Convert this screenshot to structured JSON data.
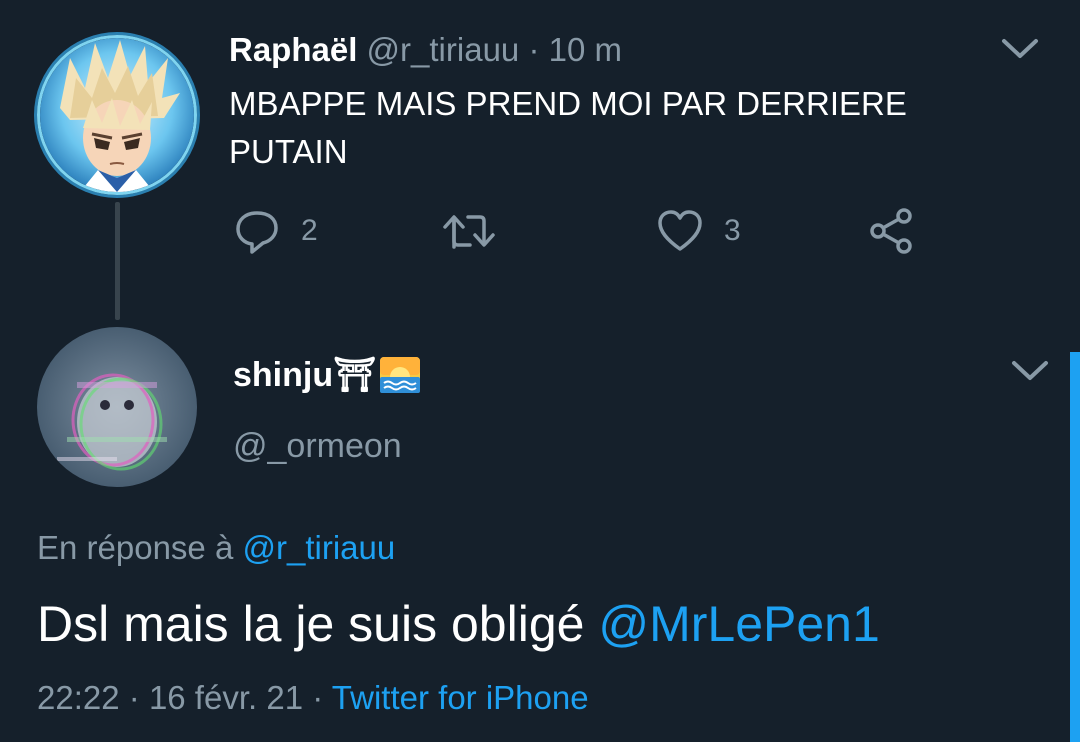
{
  "parent_tweet": {
    "display_name": "Raphaël",
    "handle": "@r_tiriauu",
    "separator": "·",
    "time": "10 m",
    "text": "MBAPPE MAIS PREND MOI PAR DERRIERE\nPUTAIN",
    "reply_count": "2",
    "like_count": "3",
    "avatar_icon": "anime-character-avatar",
    "menu_icon": "chevron-down-icon"
  },
  "reply_tweet": {
    "display_name": "shinju⛩",
    "handle": "@_ormeon",
    "avatar_icon": "glitch-art-avatar",
    "in_reply_label": "En réponse à",
    "in_reply_handle": "@r_tiriauu",
    "text_prefix": "Dsl mais la je suis obligé ",
    "text_mention": "@MrLePen1",
    "time": "22:22",
    "separator": "·",
    "date": "16 févr. 21",
    "source": "Twitter for iPhone",
    "menu_icon": "chevron-down-icon"
  },
  "colors": {
    "background": "#15202b",
    "text_primary": "#ffffff",
    "text_secondary": "#8899a6",
    "accent": "#1da1f2",
    "thread_line": "#38444d"
  }
}
